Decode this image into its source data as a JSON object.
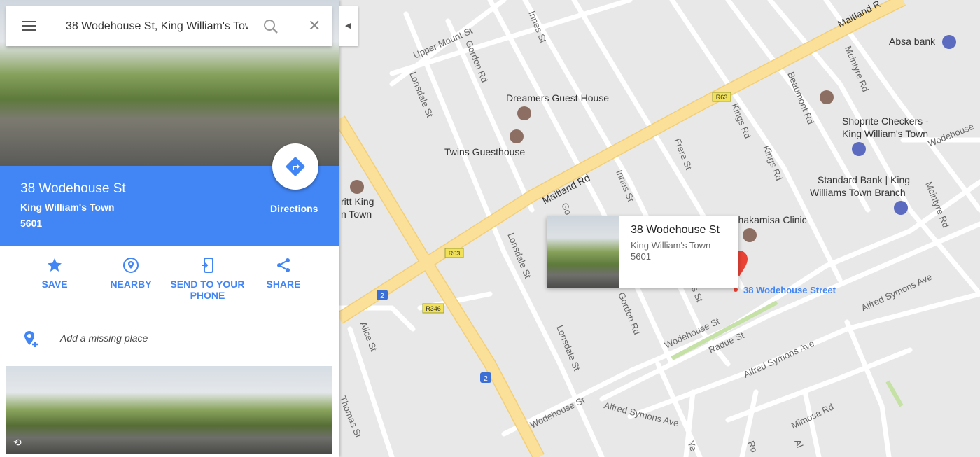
{
  "search": {
    "query": "38 Wodehouse St, King William's Town"
  },
  "place": {
    "title": "38 Wodehouse St",
    "city": "King William's Town",
    "postal_code": "5601",
    "directions_label": "Directions"
  },
  "actions": [
    {
      "label": "SAVE",
      "icon": "star-icon"
    },
    {
      "label": "NEARBY",
      "icon": "nearby-icon"
    },
    {
      "label": "SEND TO YOUR PHONE",
      "line1": "SEND TO YOUR",
      "line2": "PHONE",
      "icon": "send-to-phone-icon"
    },
    {
      "label": "SHARE",
      "icon": "share-icon"
    }
  ],
  "add_missing_place": "Add a missing place",
  "popup": {
    "title": "38 Wodehouse St",
    "city": "King William's Town",
    "postal_code": "5601"
  },
  "map": {
    "streets": {
      "maitland_top": "Maitland R",
      "upper_mount": "Upper Mount St",
      "innes_top": "Innes St",
      "gordon_top": "Gordon Rd",
      "lonsdale_top": "Lonsdale St",
      "maitland_main": "Maitland Rd",
      "frere": "Frere St",
      "kings1": "Kings Rd",
      "kings2": "Kings Rd",
      "beaumont": "Beaumont Rd",
      "mcintyre_top": "Mcintyre Rd",
      "mcintyre_right": "Mcintyre Rd",
      "wodehouse_right": "Wodehouse",
      "innes_mid": "Innes St",
      "gordon_partial": "Go",
      "lonsdale_mid": "Lonsdale St",
      "gordon_bottom": "Gordon Rd",
      "innes_partial": "es St",
      "wodehouse_mid": "Wodehouse St",
      "radue": "Radue St",
      "alfred_right": "Alfred Symons Ave",
      "alfred_mid": "Alfred Symons Ave",
      "alfred_bottom": "Alfred Symons Ave",
      "lonsdale_bottom": "Lonsdale St",
      "wodehouse_bottom": "Wodehouse St",
      "alice": "Alice St",
      "thomas": "Thomas St",
      "mimosa": "Mimosa Rd",
      "ye_partial": "Ye",
      "ro_partial": "Ro",
      "al_partial": "Al"
    },
    "pois": {
      "dreamers": "Dreamers Guest House",
      "twins": "Twins Guesthouse",
      "absa": "Absa bank",
      "shoprite_line1": "Shoprite Checkers -",
      "shoprite_line2": "King William's Town",
      "standard_line1": "Standard Bank | King",
      "standard_line2": "Williams Town Branch",
      "thakamisa": "Thakamisa Clinic",
      "britt_line1": "ritt King",
      "britt_line2": "n Town",
      "pin_label": "38 Wodehouse Street"
    },
    "shields": {
      "r63_top": "R63",
      "r63_bottom": "R63",
      "r346": "R346",
      "n2_a": "2",
      "n2_b": "2"
    },
    "colors": {
      "major_road": "#fbe09a",
      "minor_road": "#ffffff",
      "background": "#e8e8e8",
      "pin": "#ea4335",
      "accent": "#4285f4",
      "poi_brown": "#8d6e63",
      "poi_blue": "#5c6bc0",
      "park": "#c5e1a5"
    }
  }
}
